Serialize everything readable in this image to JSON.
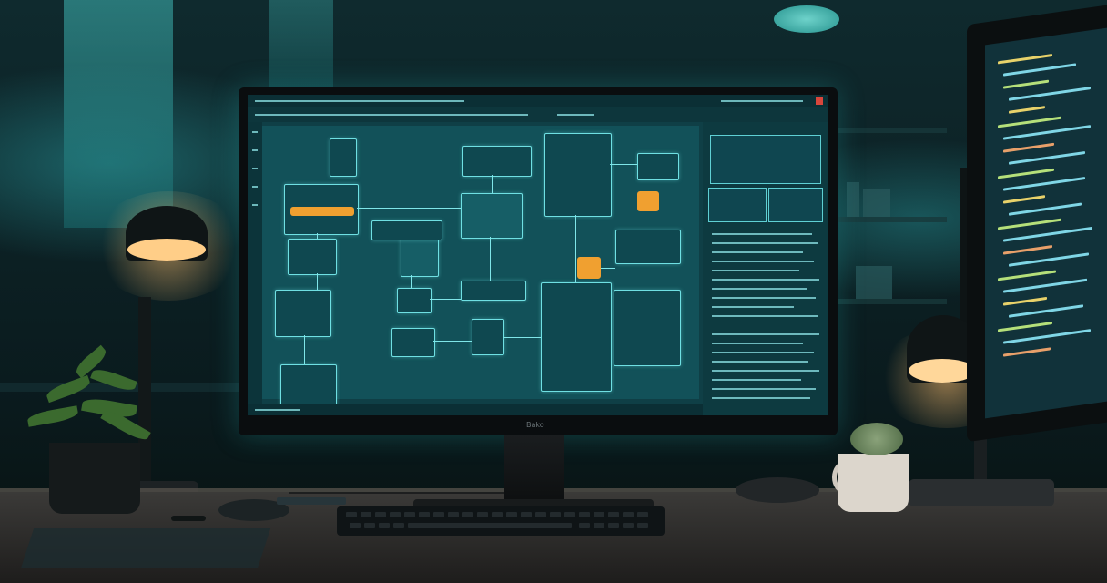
{
  "scene": {
    "description_tags": [
      "desk",
      "monitor",
      "flowchart-software",
      "plants",
      "lamps",
      "mug",
      "keyboard",
      "mouse"
    ],
    "colors": {
      "screen_bg": "#0f3f46",
      "node_border": "#6fe0e3",
      "accent_orange": "#f0a030",
      "lamp_glow": "#ffd79a",
      "ambient_teal": "#3fb7b5"
    }
  },
  "monitor": {
    "brand": "Bako"
  }
}
